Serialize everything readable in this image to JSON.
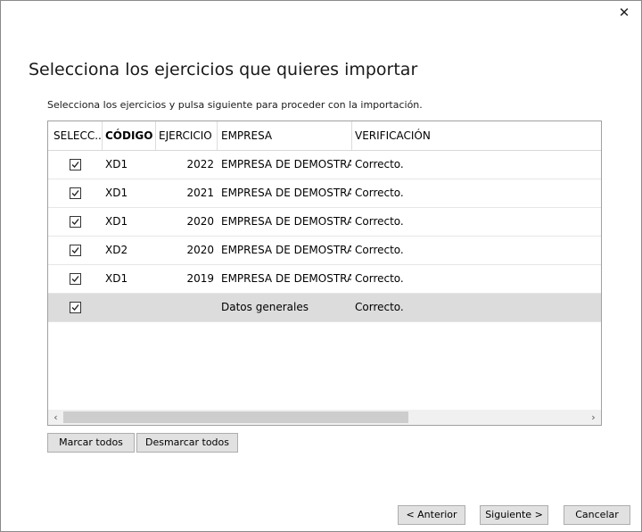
{
  "window": {
    "close_glyph": "✕",
    "heading": "Selecciona los ejercicios que quieres importar",
    "subtitle": "Selecciona los ejercicios y pulsa siguiente para proceder con la importación."
  },
  "grid": {
    "columns": {
      "select": "SELECC...",
      "code": "CÓDIGO",
      "year": "EJERCICIO",
      "company": "EMPRESA",
      "verification": "VERIFICACIÓN"
    },
    "rows": [
      {
        "checked": true,
        "code": "XD1",
        "year": "2022",
        "company": "EMPRESA DE DEMOSTRA...",
        "verification": "Correcto."
      },
      {
        "checked": true,
        "code": "XD1",
        "year": "2021",
        "company": "EMPRESA DE DEMOSTRA...",
        "verification": "Correcto."
      },
      {
        "checked": true,
        "code": "XD1",
        "year": "2020",
        "company": "EMPRESA DE DEMOSTRA...",
        "verification": "Correcto."
      },
      {
        "checked": true,
        "code": "XD2",
        "year": "2020",
        "company": "EMPRESA DE DEMOSTRA...",
        "verification": "Correcto."
      },
      {
        "checked": true,
        "code": "XD1",
        "year": "2019",
        "company": "EMPRESA DE DEMOSTRA...",
        "verification": "Correcto."
      },
      {
        "checked": true,
        "code": "",
        "year": "",
        "company": "Datos generales",
        "verification": "Correcto."
      }
    ],
    "scroll_left_glyph": "‹",
    "scroll_right_glyph": "›"
  },
  "buttons": {
    "check_all": "Marcar todos",
    "uncheck_all": "Desmarcar todos",
    "previous": "< Anterior",
    "next": "Siguiente >",
    "cancel": "Cancelar"
  },
  "colors": {
    "selected_row": "#dcdcdc",
    "button_face": "#e1e1e1",
    "button_border": "#adadad"
  }
}
